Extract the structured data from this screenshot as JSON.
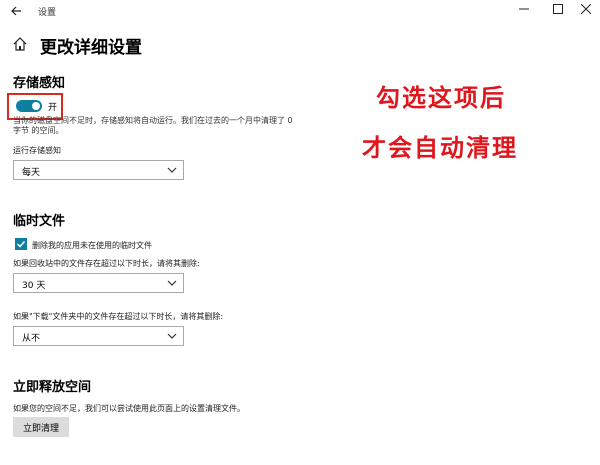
{
  "titlebar": {
    "back_icon": "back-arrow-icon",
    "title": "设置",
    "minimize_icon": "minimize-icon",
    "maximize_icon": "maximize-icon",
    "close_icon": "close-icon"
  },
  "page": {
    "home_icon": "home-icon",
    "title": "更改详细设置"
  },
  "storage_sense": {
    "heading": "存储感知",
    "toggle_state": true,
    "toggle_label": "开",
    "description": "当你的磁盘空间不足时，存储感知将自动运行。我们在过去的一个月中清理了 0 字节 的空间。",
    "run_label": "运行存储感知",
    "run_value": "每天"
  },
  "temp_files": {
    "heading": "临时文件",
    "delete_unused_checked": true,
    "delete_unused_label": "删除我的应用未在使用的临时文件",
    "recycle_label": "如果回收站中的文件存在超过以下时长，请将其删除:",
    "recycle_value": "30 天",
    "downloads_label": "如果\"下载\"文件夹中的文件存在超过以下时长，请将其删除:",
    "downloads_value": "从不"
  },
  "free_now": {
    "heading": "立即释放空间",
    "description": "如果您的空间不足，我们可以尝试使用此页面上的设置清理文件。",
    "button_label": "立即清理"
  },
  "annotation": {
    "line1": "勾选这项后",
    "line2": "才会自动清理",
    "color": "#e0161c"
  },
  "colors": {
    "accent": "#0f7fa0",
    "highlight_border": "#d62a22"
  }
}
